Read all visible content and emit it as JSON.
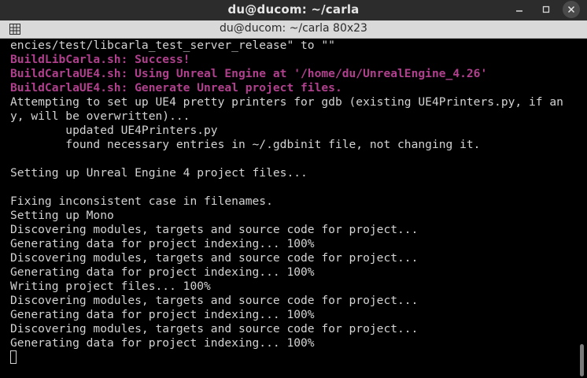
{
  "window": {
    "title": "du@ducom: ~/carla"
  },
  "tab": {
    "title": "du@ducom: ~/carla 80x23"
  },
  "terminal": {
    "lines": [
      {
        "text": "encies/test/libcarla_test_server_release\" to \"\"",
        "style": "normal"
      },
      {
        "text": "BuildLibCarla.sh: Success!",
        "style": "magenta"
      },
      {
        "text": "BuildCarlaUE4.sh: Using Unreal Engine at '/home/du/UnrealEngine_4.26'",
        "style": "magenta"
      },
      {
        "text": "BuildCarlaUE4.sh: Generate Unreal project files.",
        "style": "magenta"
      },
      {
        "text": "Attempting to set up UE4 pretty printers for gdb (existing UE4Printers.py, if an",
        "style": "normal"
      },
      {
        "text": "y, will be overwritten)...",
        "style": "normal"
      },
      {
        "text": "        updated UE4Printers.py",
        "style": "normal"
      },
      {
        "text": "        found necessary entries in ~/.gdbinit file, not changing it.",
        "style": "normal"
      },
      {
        "text": "",
        "style": "normal"
      },
      {
        "text": "Setting up Unreal Engine 4 project files...",
        "style": "normal"
      },
      {
        "text": "",
        "style": "normal"
      },
      {
        "text": "Fixing inconsistent case in filenames.",
        "style": "normal"
      },
      {
        "text": "Setting up Mono",
        "style": "normal"
      },
      {
        "text": "Discovering modules, targets and source code for project...",
        "style": "normal"
      },
      {
        "text": "Generating data for project indexing... 100%",
        "style": "normal"
      },
      {
        "text": "Discovering modules, targets and source code for project...",
        "style": "normal"
      },
      {
        "text": "Generating data for project indexing... 100%",
        "style": "normal"
      },
      {
        "text": "Writing project files... 100%",
        "style": "normal"
      },
      {
        "text": "Discovering modules, targets and source code for project...",
        "style": "normal"
      },
      {
        "text": "Generating data for project indexing... 100%",
        "style": "normal"
      },
      {
        "text": "Discovering modules, targets and source code for project...",
        "style": "normal"
      },
      {
        "text": "Generating data for project indexing... 100%",
        "style": "normal"
      }
    ]
  },
  "colors": {
    "background": "#000000",
    "text": "#d3d3d3",
    "highlight": "#b0408e",
    "titlebar": "#2c2c2c",
    "tabbar": "#d9d9d9"
  },
  "icons": {
    "tab": "terminal-tab-icon",
    "minimize": "minimize-icon",
    "maximize": "maximize-icon",
    "close": "close-icon"
  }
}
